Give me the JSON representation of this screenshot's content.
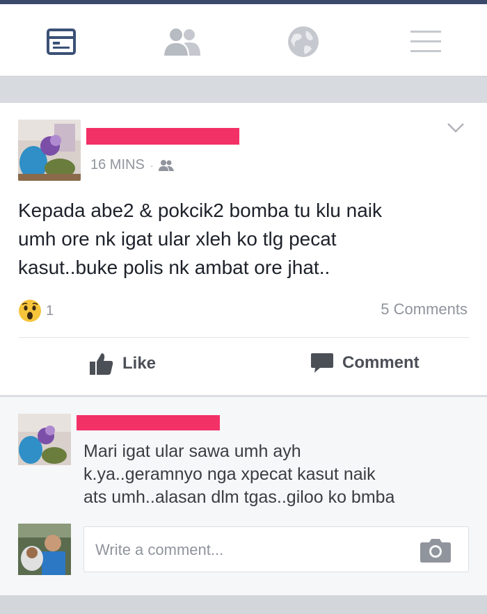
{
  "nav": {
    "items": [
      {
        "icon": "news-feed-icon",
        "active": true
      },
      {
        "icon": "friends-icon",
        "active": false
      },
      {
        "icon": "globe-icon",
        "active": false
      },
      {
        "icon": "menu-icon",
        "active": false
      }
    ]
  },
  "post": {
    "time": "16 MINS",
    "separator": "·",
    "audience_icon": "friends-small-icon",
    "text": "Kepada abe2 & pokcik2 bomba tu klu naik\numh ore nk igat ular xleh ko tlg pecat\nkasut..buke polis nk ambat ore jhat..",
    "reaction_icon": "wow-reaction-icon",
    "reaction_count": "1",
    "comments_count": "5 Comments",
    "like_label": "Like",
    "comment_label": "Comment"
  },
  "comment": {
    "text": "Mari igat ular sawa umh ayh\nk.ya..geramnyo nga xpecat kasut naik\nats umh..alasan dlm tgas..giloo ko bmba"
  },
  "composer": {
    "placeholder": "Write a comment...",
    "icon": "camera-icon"
  },
  "colors": {
    "redaction": "#f23167",
    "accent": "#3b4a6b",
    "muted_text": "#90949c"
  }
}
